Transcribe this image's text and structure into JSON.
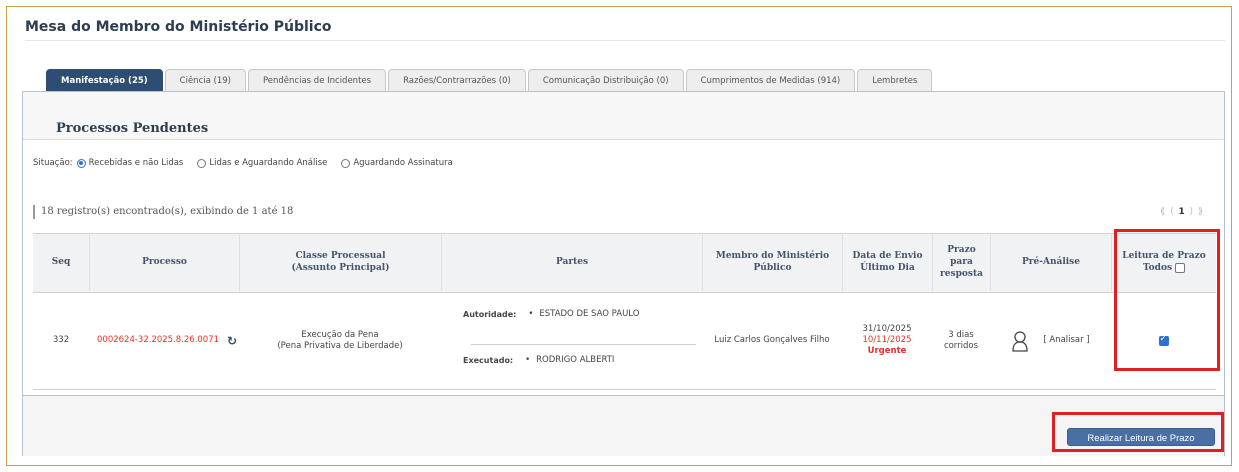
{
  "page_title": "Mesa do Membro do Ministério Público",
  "tabs": [
    {
      "label": "Manifestação (25)",
      "active": true
    },
    {
      "label": "Ciência (19)",
      "active": false
    },
    {
      "label": "Pendências de Incidentes",
      "active": false
    },
    {
      "label": "Razões/Contrarrazões (0)",
      "active": false
    },
    {
      "label": "Comunicação Distribuição (0)",
      "active": false
    },
    {
      "label": "Cumprimentos de Medidas (914)",
      "active": false
    },
    {
      "label": "Lembretes",
      "active": false
    }
  ],
  "panel_title": "Processos Pendentes",
  "situacao": {
    "label": "Situação:",
    "options": [
      {
        "label": "Recebidas e não Lidas",
        "selected": true
      },
      {
        "label": "Lidas e Aguardando Análise",
        "selected": false
      },
      {
        "label": "Aguardando Assinatura",
        "selected": false
      }
    ]
  },
  "records_text": "18 registro(s) encontrado(s), exibindo de 1 até 18",
  "pager": {
    "first": "⟪",
    "prev": "⟨",
    "current": "1",
    "next": "⟩",
    "last": "⟫"
  },
  "table": {
    "headers": {
      "seq": "Seq",
      "processo": "Processo",
      "classe_1": "Classe Processual",
      "classe_2": "(Assunto Principal)",
      "partes": "Partes",
      "membro_1": "Membro do Ministério",
      "membro_2": "Público",
      "data_1": "Data de Envio",
      "data_2": "Último Dia",
      "prazo_1": "Prazo",
      "prazo_2": "para",
      "prazo_3": "resposta",
      "pre_analise": "Pré-Análise",
      "leitura_1": "Leitura de Prazo",
      "leitura_2": "Todos"
    },
    "rows": [
      {
        "seq": "332",
        "processo": "0002624-32.2025.8.26.0071",
        "classe_1": "Execução da Pena",
        "classe_2": "(Pena Privativa de Liberdade)",
        "autoridade_label": "Autoridade:",
        "autoridade": "ESTADO DE SAO PAULO",
        "executado_label": "Executado:",
        "executado": "RODRIGO ALBERTI",
        "membro": "Luiz Carlos Gonçalves Filho",
        "data_envio": "31/10/2025",
        "ultimo_dia": "10/11/2025",
        "urgente": "Urgente",
        "prazo_1": "3 dias",
        "prazo_2": "corridos",
        "analisar": "[ Analisar ]",
        "leitura_checked": true
      }
    ]
  },
  "action_button": "Realizar Leitura de Prazo",
  "colors": {
    "accent": "#2d4d73",
    "alert": "#e4322b",
    "highlight": "#e02020"
  }
}
